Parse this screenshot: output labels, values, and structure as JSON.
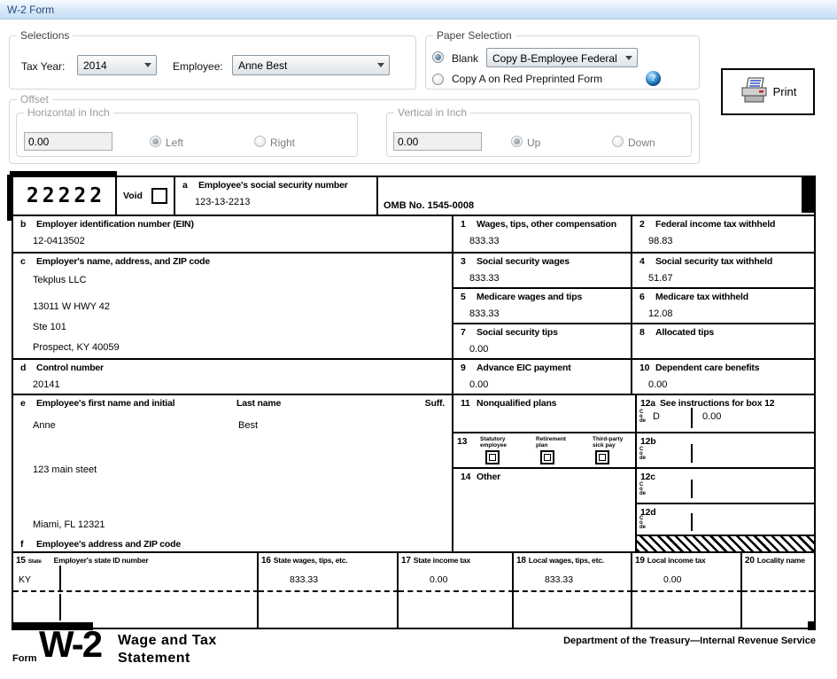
{
  "window": {
    "title": "W-2 Form"
  },
  "selections": {
    "legend": "Selections",
    "tax_year_label": "Tax Year:",
    "tax_year_value": "2014",
    "employee_label": "Employee:",
    "employee_value": "Anne Best"
  },
  "paper_selection": {
    "legend": "Paper Selection",
    "blank_label": "Blank",
    "copy_value": "Copy B-Employee Federal",
    "copy_a_label": "Copy A on Red Preprinted Form",
    "help_glyph": "?"
  },
  "print_button": {
    "label": "Print"
  },
  "offset": {
    "legend": "Offset",
    "horizontal": {
      "legend": "Horizontal in Inch",
      "value": "0.00",
      "left_label": "Left",
      "right_label": "Right"
    },
    "vertical": {
      "legend": "Vertical in Inch",
      "value": "0.00",
      "up_label": "Up",
      "down_label": "Down"
    }
  },
  "form": {
    "control_code": "22222",
    "void_label": "Void",
    "omb": "OMB No. 1545-0008",
    "box_a": {
      "num": "a",
      "label": "Employee's social security number",
      "value": "123-13-2213"
    },
    "box_b": {
      "num": "b",
      "label": "Employer identification number (EIN)",
      "value": "12-0413502"
    },
    "box_c": {
      "num": "c",
      "label": "Employer's name, address, and ZIP code",
      "lines": [
        "Tekplus LLC",
        "13011 W HWY 42",
        "Ste 101",
        "Prospect, KY 40059"
      ]
    },
    "box_d": {
      "num": "d",
      "label": "Control number",
      "value": "20141"
    },
    "box_e": {
      "num": "e",
      "label": "Employee's first name and initial",
      "last_name_label": "Last name",
      "suff_label": "Suff.",
      "first_name": "Anne",
      "last_name": "Best",
      "address_line": "123 main steet",
      "city_line": "Miami, FL 12321"
    },
    "box_f": {
      "num": "f",
      "label": "Employee's address and ZIP code"
    },
    "box1": {
      "num": "1",
      "label": "Wages, tips, other compensation",
      "value": "833.33"
    },
    "box2": {
      "num": "2",
      "label": "Federal income tax withheld",
      "value": "98.83"
    },
    "box3": {
      "num": "3",
      "label": "Social security wages",
      "value": "833.33"
    },
    "box4": {
      "num": "4",
      "label": "Social security tax withheld",
      "value": "51.67"
    },
    "box5": {
      "num": "5",
      "label": "Medicare wages and tips",
      "value": "833.33"
    },
    "box6": {
      "num": "6",
      "label": "Medicare tax withheld",
      "value": "12.08"
    },
    "box7": {
      "num": "7",
      "label": "Social security tips",
      "value": "0.00"
    },
    "box8": {
      "num": "8",
      "label": "Allocated tips",
      "value": ""
    },
    "box9": {
      "num": "9",
      "label": "Advance EIC payment",
      "value": "0.00"
    },
    "box10": {
      "num": "10",
      "label": "Dependent care benefits",
      "value": "0.00"
    },
    "box11": {
      "num": "11",
      "label": "Nonqualified plans",
      "value": ""
    },
    "box12a": {
      "num": "12a",
      "label": "See instructions for box 12",
      "code_word": "Code",
      "code": "D",
      "value": "0.00"
    },
    "box12b": {
      "num": "12b",
      "code_word": "Code"
    },
    "box12c": {
      "num": "12c",
      "code_word": "Code"
    },
    "box12d": {
      "num": "12d",
      "code_word": "Code"
    },
    "box13": {
      "num": "13",
      "items": [
        {
          "label": "Statutory employee"
        },
        {
          "label": "Retirement plan"
        },
        {
          "label": "Third-party sick pay"
        }
      ]
    },
    "box14": {
      "num": "14",
      "label": "Other"
    },
    "state": {
      "col15": {
        "num": "15",
        "small": "State",
        "label": "Employer's state ID number",
        "value": "KY"
      },
      "col16": {
        "num": "16",
        "label": "State wages, tips, etc.",
        "value": "833.33"
      },
      "col17": {
        "num": "17",
        "label": "State income tax",
        "value": "0.00"
      },
      "col18": {
        "num": "18",
        "label": "Local wages, tips, etc.",
        "value": "833.33"
      },
      "col19": {
        "num": "19",
        "label": "Local income tax",
        "value": "0.00"
      },
      "col20": {
        "num": "20",
        "label": "Locality name",
        "value": ""
      }
    }
  },
  "footer": {
    "form_word": "Form",
    "form_number": "W-2",
    "title_line1": "Wage and Tax",
    "title_line2": "Statement",
    "department": "Department of the Treasury—Internal Revenue Service"
  }
}
